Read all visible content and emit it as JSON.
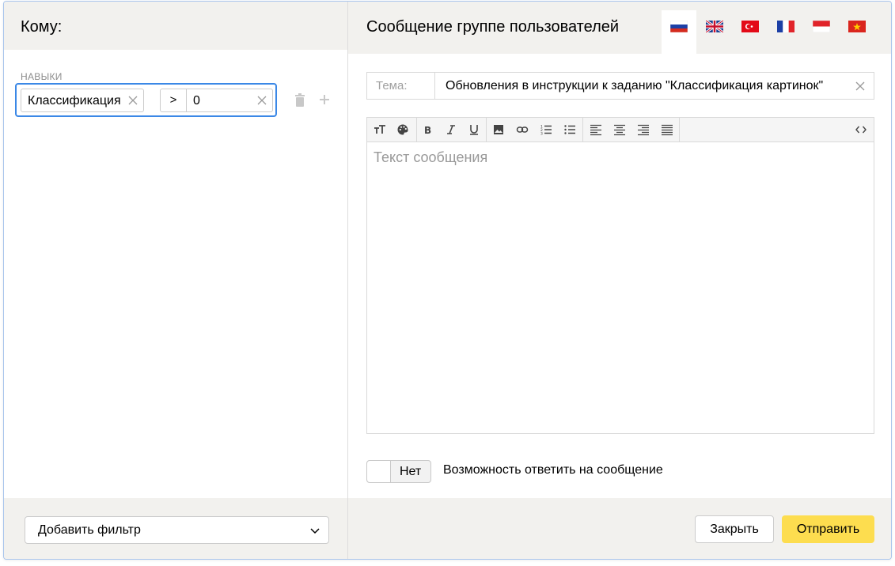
{
  "recipients": {
    "title": "Кому:",
    "skills_label": "НАВЫКИ",
    "filter": {
      "skill_value": "Классификация картинок",
      "operator": ">",
      "value": "0"
    },
    "add_filter_label": "Добавить фильтр"
  },
  "message": {
    "title": "Сообщение группе пользователей",
    "languages": [
      {
        "icon": "flag-ru-icon",
        "active": true
      },
      {
        "icon": "flag-gb-icon",
        "active": false
      },
      {
        "icon": "flag-tr-icon",
        "active": false
      },
      {
        "icon": "flag-fr-icon",
        "active": false
      },
      {
        "icon": "flag-id-icon",
        "active": false
      },
      {
        "icon": "flag-vn-icon",
        "active": false
      }
    ],
    "subject_label": "Тема:",
    "subject_value": "Обновления в инструкции к заданию \"Классификация картинок\"",
    "toolbar": [
      "font-size-icon",
      "palette-icon",
      "bold-icon",
      "italic-icon",
      "underline-icon",
      "image-icon",
      "link-icon",
      "ordered-list-icon",
      "bullet-list-icon",
      "align-left-icon",
      "align-center-icon",
      "align-right-icon",
      "align-justify-icon",
      "code-view-icon"
    ],
    "body_placeholder": "Текст сообщения",
    "reply_toggle_state": "Нет",
    "reply_toggle_label": "Возможность ответить на сообщение"
  },
  "footer": {
    "close_label": "Закрыть",
    "send_label": "Отправить"
  },
  "colors": {
    "panel_bg": "#f2f1ee",
    "focus_border": "#3b88e6",
    "send_button": "#fddd4f"
  }
}
